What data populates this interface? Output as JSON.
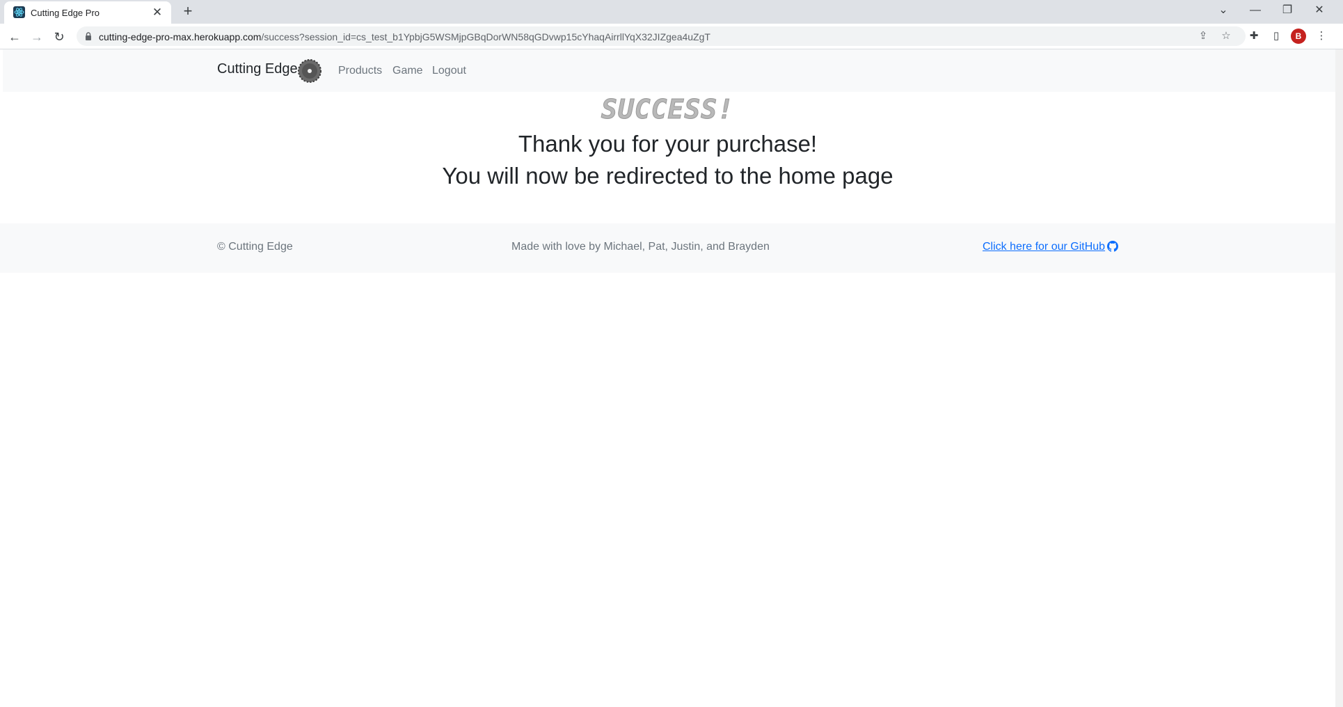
{
  "browser": {
    "tab_title": "Cutting Edge Pro",
    "tab_close": "✕",
    "new_tab": "+",
    "url_host": "cutting-edge-pro-max.herokuapp.com",
    "url_path": "/success?session_id=cs_test_b1YpbjG5WSMjpGBqDorWN58qGDvwp15cYhaqAirrllYqX32JIZgea4uZgT",
    "profile_initial": "B",
    "icons": {
      "back": "back-arrow-icon",
      "forward": "forward-arrow-icon",
      "reload": "reload-icon",
      "lock": "lock-icon",
      "share": "share-icon",
      "bookmark": "star-icon",
      "extensions": "puzzle-icon",
      "side_panel": "side-panel-icon",
      "menu": "kebab-menu-icon"
    }
  },
  "navbar": {
    "brand": "Cutting Edge",
    "links": [
      "Products",
      "Game",
      "Logout"
    ]
  },
  "main": {
    "banner": "SUCCESS!",
    "line1": "Thank you for your purchase!",
    "line2": "You will now be redirected to the home page"
  },
  "footer": {
    "copyright": "© Cutting Edge",
    "credits": "Made with love by Michael, Pat, Justin, and Brayden",
    "github_link": "Click here for our GitHub"
  },
  "colors": {
    "navbar_bg": "#f8f9fa",
    "link_muted": "#6c757d",
    "link_primary": "#0d6efd",
    "text_dark": "#212529"
  }
}
